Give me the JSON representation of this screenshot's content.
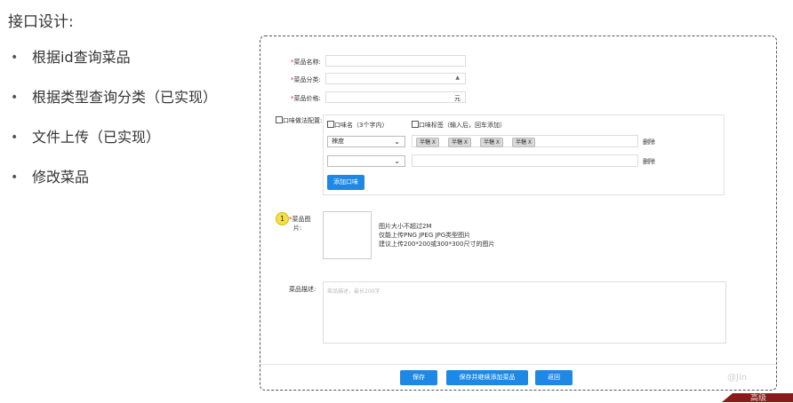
{
  "slide": {
    "title": "接口设计:",
    "bullets": [
      "根据id查询菜品",
      "根据类型查询分类（已实现）",
      "文件上传（已实现）",
      "修改菜品"
    ]
  },
  "form": {
    "name_label": "菜品名称:",
    "category_label": "菜品分类:",
    "price_label": "菜品价格:",
    "price_unit": "元",
    "required_mark": "*",
    "flavor_label": "口味做法配置:",
    "flavor_name_header": "口味名（3个字内）",
    "flavor_tags_header": "口味标签（输入后，回车添加）",
    "flavor_rows": [
      {
        "name": "辣度",
        "tags": [
          "半糖 X",
          "半糖 X",
          "半糖 X",
          "半糖 X"
        ],
        "delete": "删除"
      },
      {
        "name": "",
        "tags": [],
        "delete": "删除"
      }
    ],
    "add_flavor_button": "添加口味",
    "image_label_line1": "菜品图",
    "image_label_line2": "片:",
    "step_badge": "1",
    "upload_tips": [
      "图片大小不超过2M",
      "仅能上传PNG JPEG JPG类型图片",
      "建议上传200*200或300*300尺寸的图片"
    ],
    "desc_label": "菜品描述:",
    "desc_placeholder": "菜品描述，最长200字",
    "buttons": {
      "save": "保存",
      "save_continue": "保存并继续添加菜品",
      "back": "返回"
    }
  },
  "overlay": {
    "watermark": "@Jin",
    "corner_text": "高级"
  },
  "colors": {
    "primary_button": "#1e88e5",
    "required": "#e23",
    "badge": "#f4e04d",
    "corner": "#8b1a1a"
  }
}
